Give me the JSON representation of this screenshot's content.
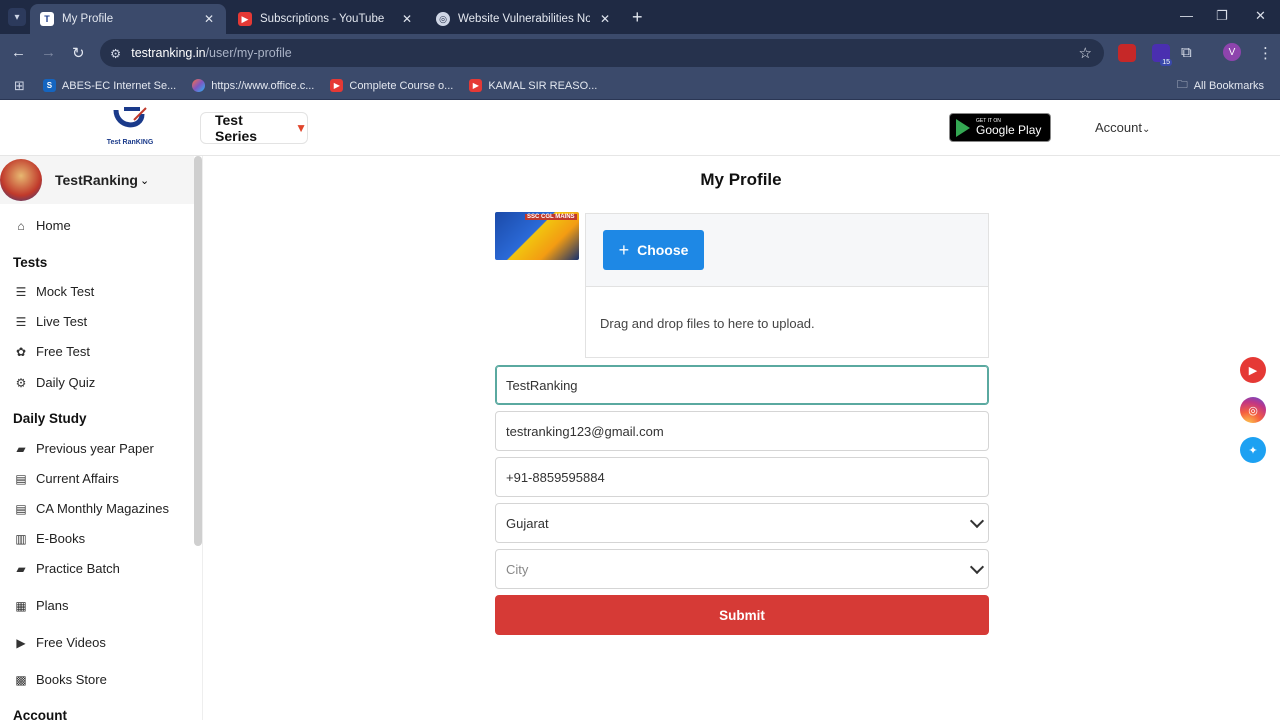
{
  "browser": {
    "tabs": [
      {
        "title": "My Profile",
        "active": true
      },
      {
        "title": "Subscriptions - YouTube",
        "active": false
      },
      {
        "title": "Website Vulnerabilities Notifica",
        "active": false
      }
    ],
    "url_host": "testranking.in",
    "url_path": "/user/my-profile",
    "extension_badge": "15",
    "profile_initial": "V",
    "bookmarks": [
      {
        "label": "ABES-EC Internet Se...",
        "icon": "S"
      },
      {
        "label": "https://www.office.c...",
        "icon": "office"
      },
      {
        "label": "Complete Course o...",
        "icon": "youtube"
      },
      {
        "label": "KAMAL SIR REASO...",
        "icon": "youtube"
      }
    ],
    "all_bookmarks": "All Bookmarks"
  },
  "header": {
    "logo_text": "Test RanKING",
    "test_series": "Test Series",
    "gplay_line1": "GET IT ON",
    "gplay_line2": "Google Play",
    "account": "Account"
  },
  "sidebar": {
    "username": "TestRanking",
    "home": "Home",
    "section_tests": "Tests",
    "mock_test": "Mock Test",
    "live_test": "Live Test",
    "free_test": "Free Test",
    "daily_quiz": "Daily Quiz",
    "section_daily": "Daily Study",
    "prev_year": "Previous year Paper",
    "current_affairs": "Current Affairs",
    "ca_monthly": "CA Monthly Magazines",
    "ebooks": "E-Books",
    "practice_batch": "Practice Batch",
    "plans": "Plans",
    "free_videos": "Free Videos",
    "books_store": "Books Store",
    "section_account": "Account"
  },
  "profile": {
    "title": "My Profile",
    "thumb_text": "SSC CGL MAINS",
    "choose": "Choose",
    "drop_text": "Drag and drop files to here to upload.",
    "name_value": "TestRanking",
    "email_value": "testranking123@gmail.com",
    "phone_value": "+91-8859595884",
    "state_value": "Gujarat",
    "city_placeholder": "City",
    "submit": "Submit"
  },
  "colors": {
    "accent_blue": "#1e88e5",
    "submit_red": "#d63a36",
    "youtube_red": "#e53935",
    "twitter_blue": "#1da1f2"
  }
}
